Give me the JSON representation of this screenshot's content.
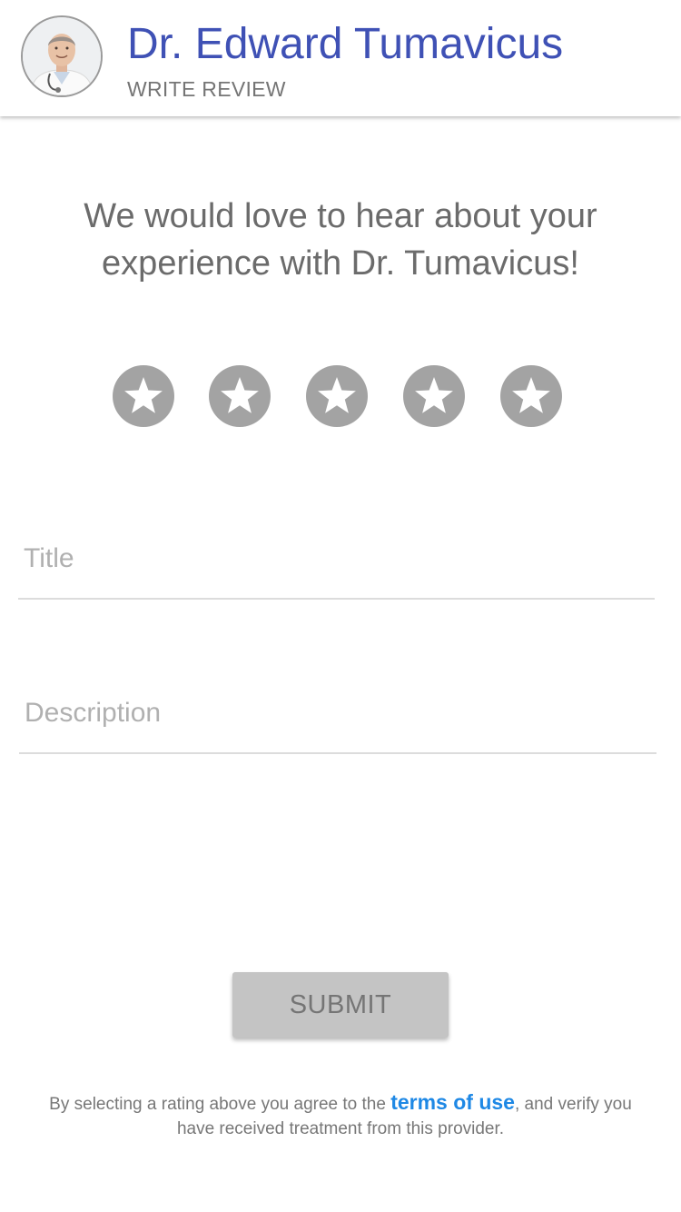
{
  "header": {
    "doctor_name": "Dr. Edward Tumavicus",
    "subtitle": "WRITE REVIEW",
    "avatar_icon": "doctor-avatar-photo"
  },
  "prompt": {
    "text": "We would love to hear about your experience with Dr. Tumavicus!"
  },
  "rating": {
    "max": 5,
    "selected": 0,
    "star_icon": "star-icon",
    "star_color": "#a3a3a3"
  },
  "form": {
    "title_placeholder": "Title",
    "title_value": "",
    "description_placeholder": "Description",
    "description_value": ""
  },
  "submit": {
    "label": "SUBMIT"
  },
  "disclaimer": {
    "before": "By selecting a rating above you agree to the ",
    "link": "terms of use",
    "after": ", and verify you have received treatment from this provider."
  },
  "colors": {
    "accent": "#3f51b5",
    "link": "#1e88e5",
    "button_bg": "#c4c4c4"
  }
}
